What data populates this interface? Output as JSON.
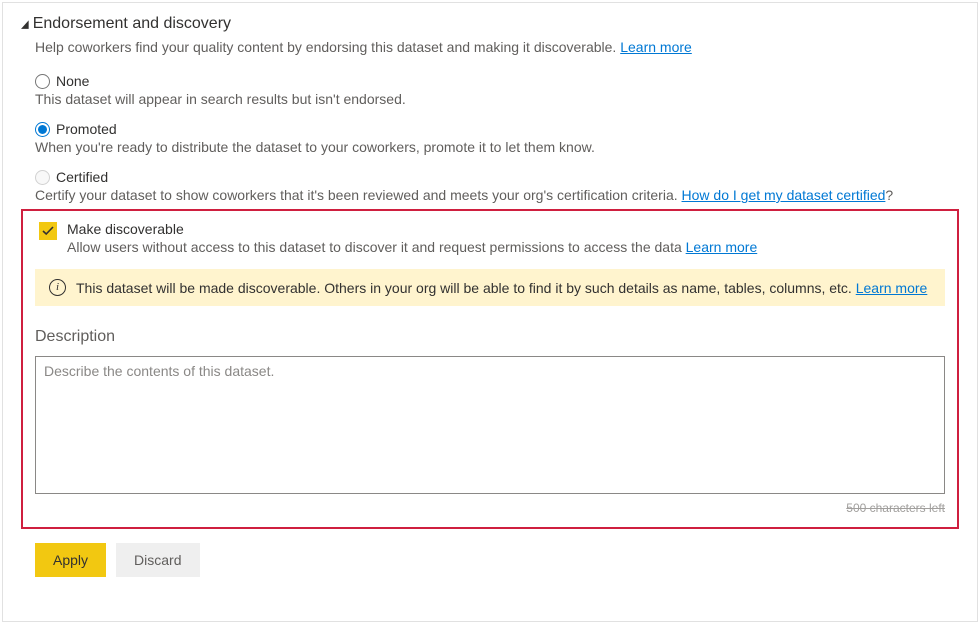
{
  "section": {
    "title": "Endorsement and discovery",
    "help": "Help coworkers find your quality content by endorsing this dataset and making it discoverable.",
    "help_link": "Learn more"
  },
  "options": {
    "none": {
      "label": "None",
      "desc": "This dataset will appear in search results but isn't endorsed."
    },
    "promoted": {
      "label": "Promoted",
      "desc": "When you're ready to distribute the dataset to your coworkers, promote it to let them know."
    },
    "certified": {
      "label": "Certified",
      "desc": "Certify your dataset to show coworkers that it's been reviewed and meets your org's certification criteria.",
      "link": "How do I get my dataset certified",
      "q": "?"
    }
  },
  "discoverable": {
    "label": "Make discoverable",
    "desc": "Allow users without access to this dataset to discover it and request permissions to access the data",
    "link": "Learn more"
  },
  "banner": {
    "text": "This dataset will be made discoverable. Others in your org will be able to find it by such details as name, tables, columns, etc.",
    "link": "Learn more"
  },
  "description": {
    "label": "Description",
    "placeholder": "Describe the contents of this dataset.",
    "characters_left": "500 characters left"
  },
  "buttons": {
    "apply": "Apply",
    "discard": "Discard"
  }
}
